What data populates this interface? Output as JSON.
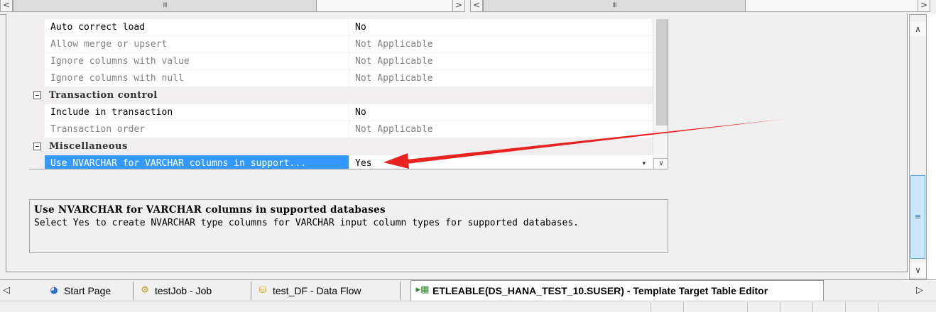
{
  "top_scrollbars": {
    "left_arrow_glyph": "<",
    "right_arrow_glyph": ">",
    "thumb_glyph": "III"
  },
  "property_grid": {
    "rows": [
      {
        "name": "Auto correct load",
        "value": "No",
        "state": "enabled"
      },
      {
        "name": "Allow merge or upsert",
        "value": "Not Applicable",
        "state": "disabled"
      },
      {
        "name": "Ignore columns with value",
        "value": "Not Applicable",
        "state": "disabled"
      },
      {
        "name": "Ignore columns with null",
        "value": "Not Applicable",
        "state": "disabled"
      },
      {
        "category": "Transaction control"
      },
      {
        "name": "Include in transaction",
        "value": "No",
        "state": "enabled"
      },
      {
        "name": "Transaction order",
        "value": "Not Applicable",
        "state": "disabled"
      },
      {
        "category": "Miscellaneous"
      },
      {
        "name": "Use NVARCHAR for VARCHAR columns in support...",
        "value": "Yes",
        "state": "selected"
      }
    ],
    "dropdown_caret": "▾",
    "scroll_down_glyph": "∨"
  },
  "description": {
    "title": "Use NVARCHAR for VARCHAR columns in supported databases",
    "body": "Select Yes to create NVARCHAR type columns for VARCHAR input column types for supported databases."
  },
  "right_scrollbar": {
    "up_glyph": "∧",
    "down_glyph": "∨",
    "thumb_glyph": "≡"
  },
  "tabs": {
    "nav_left": "◁",
    "nav_right": "▷",
    "items": [
      {
        "label": "Start Page",
        "icon": "start-page-icon",
        "glyph": "◕"
      },
      {
        "label": "testJob - Job",
        "icon": "job-icon",
        "glyph": "⚙"
      },
      {
        "label": "test_DF - Data Flow",
        "icon": "dataflow-icon",
        "glyph": "⛁"
      },
      {
        "label": "ETLEABLE(DS_HANA_TEST_10.SUSER) - Template Target Table Editor",
        "icon": "table-editor-icon",
        "glyph": "▸▦",
        "active": true
      }
    ]
  },
  "colors": {
    "selection": "#3399ff",
    "annotation_arrow": "#e8231f",
    "scroll_thumb": "#c9e6fb"
  }
}
